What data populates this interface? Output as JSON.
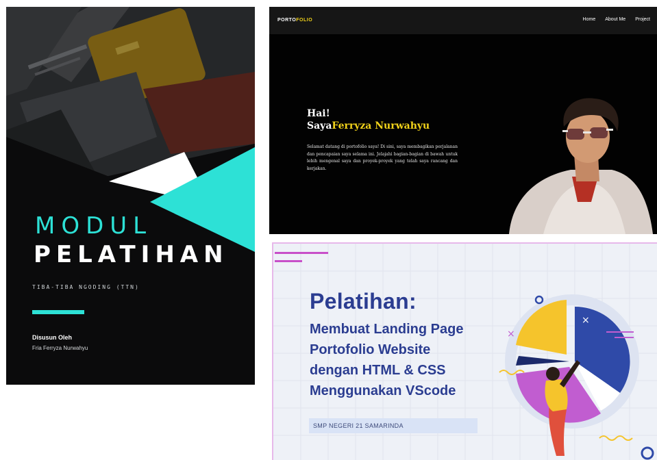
{
  "cover": {
    "title_line1": "MODUL",
    "title_line2": "PELATIHAN",
    "subtitle": "TIBA-TIBA NGODING (TTN)",
    "by_label": "Disusun Oleh",
    "author": "Fria Ferryza Nurwahyu",
    "accent_color": "#2de1d6"
  },
  "portfolio": {
    "logo_part1": "PORTO",
    "logo_part2": "FOLIO",
    "nav": [
      "Home",
      "About Me",
      "Project"
    ],
    "greeting": "Hai!",
    "name_prefix": "Saya",
    "name": "Ferryza Nurwahyu",
    "description": "Selamat datang di portofolio saya! Di sini, saya membagikan perjalanan dan pencapaian saya selama ini. Jelajahi bagian-bagian di bawah untuk lebih mengenal saya dan proyek-proyek yang telah saya rancang dan kerjakan.",
    "accent_color": "#f1d21a"
  },
  "slide": {
    "title": "Pelatihan:",
    "lines": [
      "Membuat Landing Page",
      "Portofolio Website",
      "dengan HTML & CSS",
      "Menggunakan VScode"
    ],
    "school": "SMP NEGERI 21 SAMARINDA",
    "title_color": "#2b3d91"
  }
}
